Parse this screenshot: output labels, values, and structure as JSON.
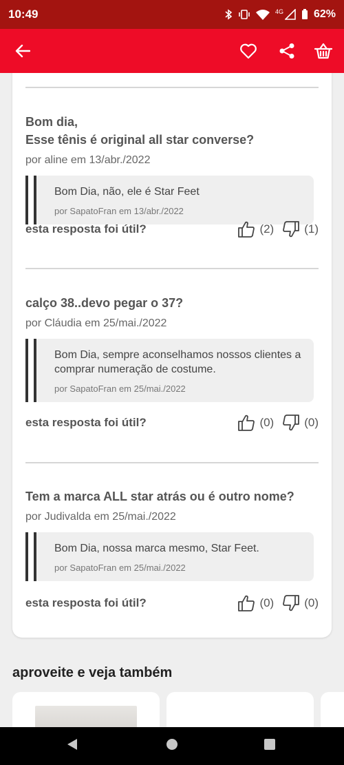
{
  "status_bar": {
    "time": "10:49",
    "network": "4G",
    "battery": "62%"
  },
  "app_bar": {
    "back_icon": "arrow-left-icon",
    "favorite_icon": "heart-outline-icon",
    "share_icon": "share-icon",
    "cart_icon": "basket-icon"
  },
  "qa": [
    {
      "question": "Bom dia,\nEsse tênis é original all star converse?",
      "asker": "por aline em 13/abr./2022",
      "answer": "Bom Dia, não, ele é Star Feet",
      "answer_by": "por SapatoFran em 13/abr./2022",
      "helpful_label": "esta resposta foi útil?",
      "likes": "(2)",
      "dislikes": "(1)"
    },
    {
      "question": "calço 38..devo pegar o 37?",
      "asker": "por Cláudia em 25/mai./2022",
      "answer": "Bom Dia, sempre aconselhamos nossos clientes a comprar numeração de costume.",
      "answer_by": "por SapatoFran em 25/mai./2022",
      "helpful_label": "esta resposta foi útil?",
      "likes": "(0)",
      "dislikes": "(0)"
    },
    {
      "question": "Tem a marca ALL star atrás ou é outro nome?",
      "asker": "por Judivalda em 25/mai./2022",
      "answer": "Bom Dia, nossa marca mesmo, Star Feet.",
      "answer_by": "por SapatoFran em 25/mai./2022",
      "helpful_label": "esta resposta foi útil?",
      "likes": "(0)",
      "dislikes": "(0)"
    }
  ],
  "related": {
    "title": "aproveite e veja também"
  },
  "nav_bar": {
    "back": "nav-back-icon",
    "home": "nav-home-icon",
    "recents": "nav-recents-icon"
  }
}
